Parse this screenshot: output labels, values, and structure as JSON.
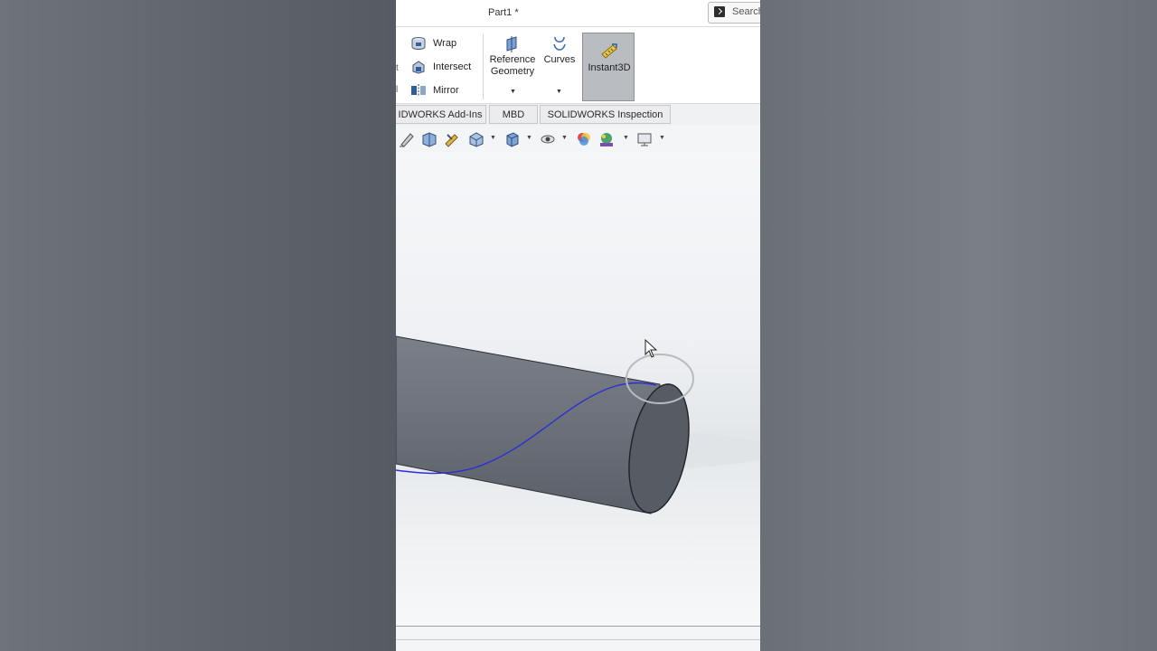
{
  "window": {
    "title": "Part1 *",
    "search_placeholder": "Search"
  },
  "ribbon": {
    "wrap_label": "Wrap",
    "intersect_label": "Intersect",
    "mirror_label": "Mirror",
    "reference_geometry_label_1": "Reference",
    "reference_geometry_label_2": "Geometry",
    "curves_label": "Curves",
    "instant3d_label": "Instant3D",
    "instant3d_active": true
  },
  "tabs": [
    {
      "label": "IDWORKS Add-Ins"
    },
    {
      "label": "MBD"
    },
    {
      "label": "SOLIDWORKS Inspection"
    }
  ],
  "view_toolbar": {
    "icons": [
      "sketch-tool-icon",
      "section-view-icon",
      "view-tools-icon",
      "view-orientation-icon",
      "display-style-icon",
      "hide-show-icon",
      "edit-appearance-icon",
      "apply-scene-icon",
      "view-settings-icon"
    ]
  },
  "colors": {
    "cylinder_body": "#6b7079",
    "cylinder_end_face": "#565b64",
    "helix_curve": "#2a2fd6",
    "selection_ring": "#b7babf",
    "instant3d_active_bg": "#b9bcc1"
  }
}
